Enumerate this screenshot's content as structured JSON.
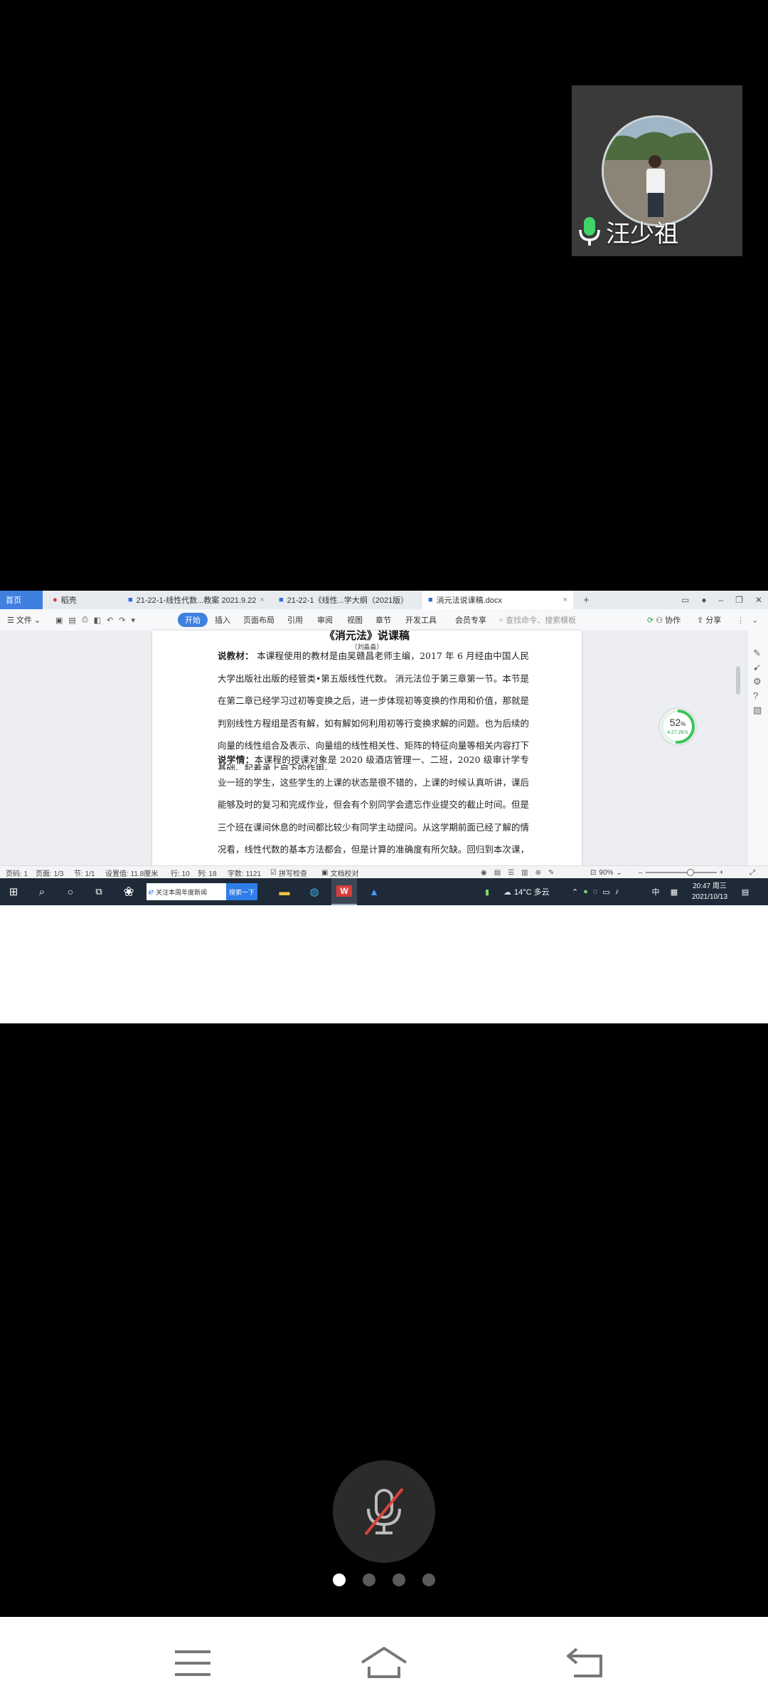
{
  "participant": {
    "name": "汪少祖"
  },
  "wps": {
    "tabs": [
      {
        "label": "首页"
      },
      {
        "label": "稻壳"
      },
      {
        "label": "21-22-1-线性代数...教案 2021.9.22"
      },
      {
        "label": "21-22-1《线性...学大纲（2021版）"
      },
      {
        "label": "消元法说课稿.docx"
      }
    ],
    "toolbar": {
      "file": "文件",
      "ribbon": [
        "开始",
        "插入",
        "页面布局",
        "引用",
        "审阅",
        "视图",
        "章节",
        "开发工具",
        "会员专享"
      ],
      "search_placeholder": "查找命令、搜索模板",
      "collab": "协作",
      "share": "分享"
    },
    "document": {
      "title": "《消元法》说课稿",
      "author": "（刘淼淼）",
      "para1_label": "说教材：",
      "para1_text": " 本课程使用的教材是由吴赣昌老师主编，2017 年 6 月经由中国人民大学出版社出版的经管类•第五版线性代数。 消元法位于第三章第一节。本节是在第二章已经学习过初等变换之后，进一步体现初等变换的作用和价值，那就是判别线性方程组是否有解，如有解如何利用初等行变换求解的问题。也为后续的向量的线性组合及表示、向量组的线性相关性、矩阵的特征向量等相关内容打下基础。起着承上启下的作用。",
      "para2_label": "说学情：",
      "para2_text": "本课程的授课对象是 2020 级酒店管理一、二班，2020 级审计学专业一班的学生，这些学生的上课的状态是很不错的，上课的时候认真听讲，课后能够及时的复习和完成作业，但会有个别同学会遗忘作业提交的截止时间。但是三个班在课间休息的时间都比较少有同学主动提问。从这学期前面已经了解的情况看，线性代数的基本方法都会，但是计算的准确度有所欠缺。回归到本次课，学生对于之前矩阵的初等变换已经很熟悉方法，但是变换过程容易计算出错，因此，"
    },
    "progress": {
      "value": "52",
      "unit": "%",
      "rate": "4.27.2K/s"
    },
    "statusbar": {
      "page": "页码: 1",
      "pages": "页面: 1/3",
      "section": "节: 1/1",
      "position": "设置值: 11.8厘米",
      "row": "行: 10",
      "col": "列: 18",
      "words": "字数: 1121",
      "spell": "拼写检查",
      "proof": "文档校对",
      "zoom": "90%"
    },
    "taskbar": {
      "search_text": "关注本周年度新闻",
      "search_button": "搜索一下",
      "weather": "14°C 多云",
      "ime": "中",
      "time": "20:47 周三",
      "date": "2021/10/13"
    }
  }
}
